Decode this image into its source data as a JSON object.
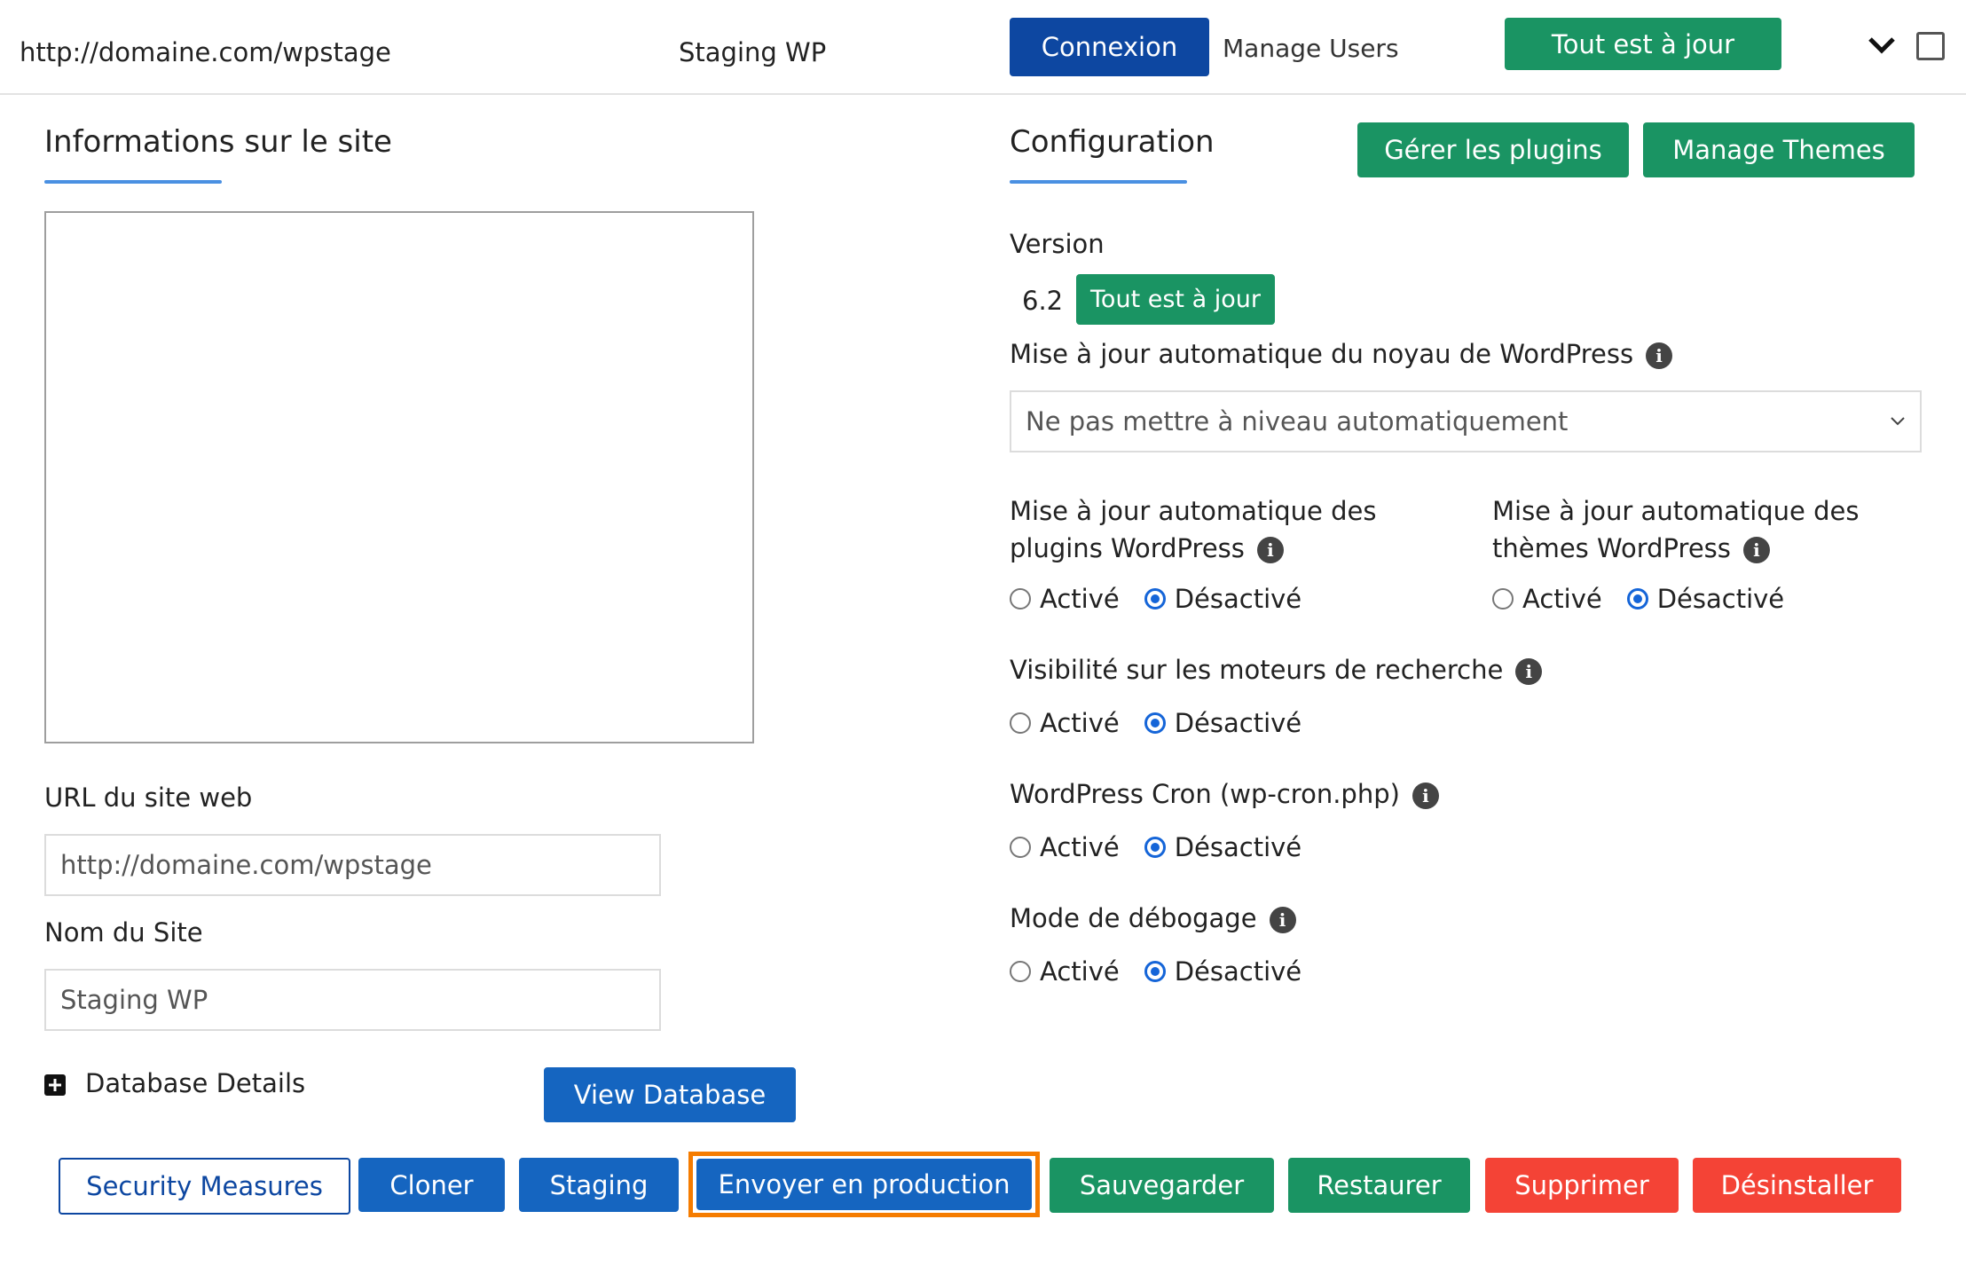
{
  "header": {
    "site_url": "http://domaine.com/wpstage",
    "site_name": "Staging WP",
    "login_button": "Connexion",
    "manage_users": "Manage Users",
    "status_button": "Tout est à jour"
  },
  "site_info": {
    "title": "Informations sur le site",
    "url_label": "URL du site web",
    "url_value": "http://domaine.com/wpstage",
    "name_label": "Nom du Site",
    "name_value": "Staging WP",
    "db_details": "Database Details",
    "view_db_button": "View Database"
  },
  "config": {
    "title": "Configuration",
    "manage_plugins_button": "Gérer les plugins",
    "manage_themes_button": "Manage Themes",
    "version_label": "Version",
    "version_value": "6.2",
    "version_status_button": "Tout est à jour",
    "core_autoupdate_label": "Mise à jour automatique du noyau de WordPress",
    "core_autoupdate_selected": "Ne pas mettre à niveau automatiquement",
    "plugins_autoupdate_label_line1": "Mise à jour automatique des",
    "plugins_autoupdate_label_line2": "plugins WordPress",
    "themes_autoupdate_label_line1": "Mise à jour automatique des",
    "themes_autoupdate_label_line2": "thèmes WordPress",
    "visibility_label": "Visibilité sur les moteurs de recherche",
    "cron_label": "WordPress Cron (wp-cron.php)",
    "debug_label": "Mode de débogage",
    "on_label": "Activé",
    "off_label": "Désactivé",
    "info_glyph": "i"
  },
  "actions": {
    "security": "Security Measures",
    "clone": "Cloner",
    "staging": "Staging",
    "push": "Envoyer en production",
    "backup": "Sauvegarder",
    "restore": "Restaurer",
    "delete": "Supprimer",
    "uninstall": "Désinstaller"
  },
  "colors": {
    "primary_blue": "#1565c0",
    "navy": "#0d47a1",
    "green": "#1a9463",
    "red": "#f44336",
    "highlight_orange": "#f57c00",
    "accent_underline": "#4a90e2"
  }
}
